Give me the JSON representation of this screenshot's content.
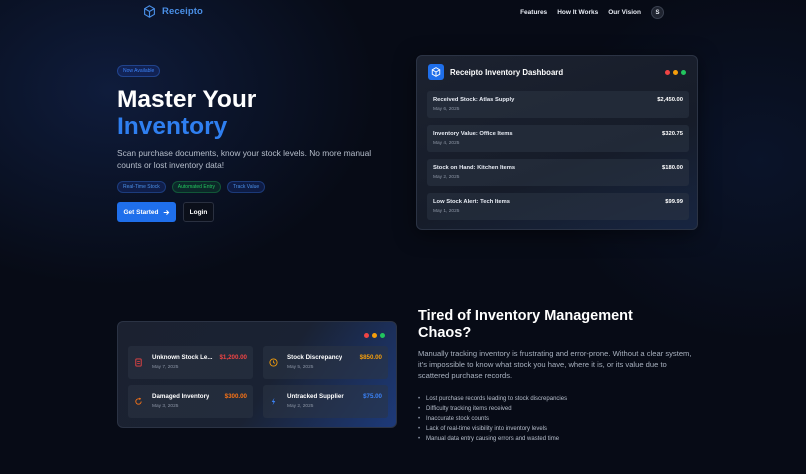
{
  "nav": {
    "brand": "Receipto",
    "links": [
      "Features",
      "How It Works",
      "Our Vision"
    ],
    "avatar_initial": "S"
  },
  "hero": {
    "badge": "Now Available",
    "title_line1": "Master Your",
    "title_line2": "Inventory",
    "description": "Scan purchase documents, know your stock levels. No more manual counts or lost inventory data!",
    "tags": [
      "Real-Time Stock",
      "Automated Entry",
      "Track Value"
    ],
    "primary_button": "Get Started",
    "secondary_button": "Login"
  },
  "dashboard": {
    "title": "Receipto Inventory Dashboard",
    "rows": [
      {
        "title": "Received Stock: Atlas Supply",
        "date": "May 6, 2025",
        "amount": "$2,450.00"
      },
      {
        "title": "Inventory Value: Office Items",
        "date": "May 4, 2025",
        "amount": "$320.75"
      },
      {
        "title": "Stock on Hand: Kitchen Items",
        "date": "May 2, 2025",
        "amount": "$180.00"
      },
      {
        "title": "Low Stock Alert: Tech Items",
        "date": "May 1, 2025",
        "amount": "$99.99"
      }
    ]
  },
  "problem_card": {
    "items": [
      {
        "title": "Unknown Stock Le...",
        "date": "May 7, 2025",
        "amount": "$1,200.00",
        "color": "#ef4444",
        "icon": "receipt-icon"
      },
      {
        "title": "Stock Discrepancy",
        "date": "May 5, 2025",
        "amount": "$850.00",
        "color": "#f59e0b",
        "icon": "clock-icon"
      },
      {
        "title": "Damaged Inventory",
        "date": "May 3, 2025",
        "amount": "$300.00",
        "color": "#f97316",
        "icon": "refresh-icon"
      },
      {
        "title": "Untracked Supplier",
        "date": "May 2, 2025",
        "amount": "$75.00",
        "color": "#3b82f6",
        "icon": "bolt-icon"
      }
    ]
  },
  "problem": {
    "title": "Tired of Inventory Management Chaos?",
    "description": "Manually tracking inventory is frustrating and error-prone. Without a clear system, it's impossible to know what stock you have, where it is, or its value due to scattered purchase records.",
    "bullets": [
      "Lost purchase records leading to stock discrepancies",
      "Difficulty tracking items received",
      "Inaccurate stock counts",
      "Lack of real-time visibility into inventory levels",
      "Manual data entry causing errors and wasted time"
    ]
  },
  "colors": {
    "accent": "#1f6feb",
    "dot_red": "#ef4444",
    "dot_yellow": "#f59e0b",
    "dot_green": "#22c55e"
  }
}
